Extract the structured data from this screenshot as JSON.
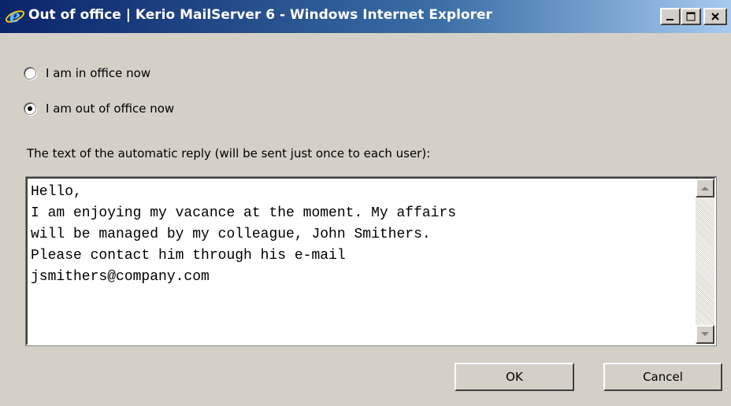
{
  "window": {
    "title": "Out of office | Kerio MailServer 6 - Windows Internet Explorer",
    "icon": "internet-explorer-icon",
    "controls": [
      "minimize-icon",
      "maximize-icon",
      "close-icon"
    ]
  },
  "status_options": {
    "in_office": {
      "label": "I am in office now",
      "checked": false
    },
    "out_of_office": {
      "label": "I am out of office now",
      "checked": true
    }
  },
  "reply": {
    "label": "The text of the automatic reply (will be sent just once to each user):",
    "value": "Hello,\nI am enjoying my vacance at the moment. My affairs\nwill be managed by my colleague, John Smithers.\nPlease contact him through his e-mail\njsmithers@company.com"
  },
  "buttons": {
    "ok": "OK",
    "cancel": "Cancel"
  }
}
